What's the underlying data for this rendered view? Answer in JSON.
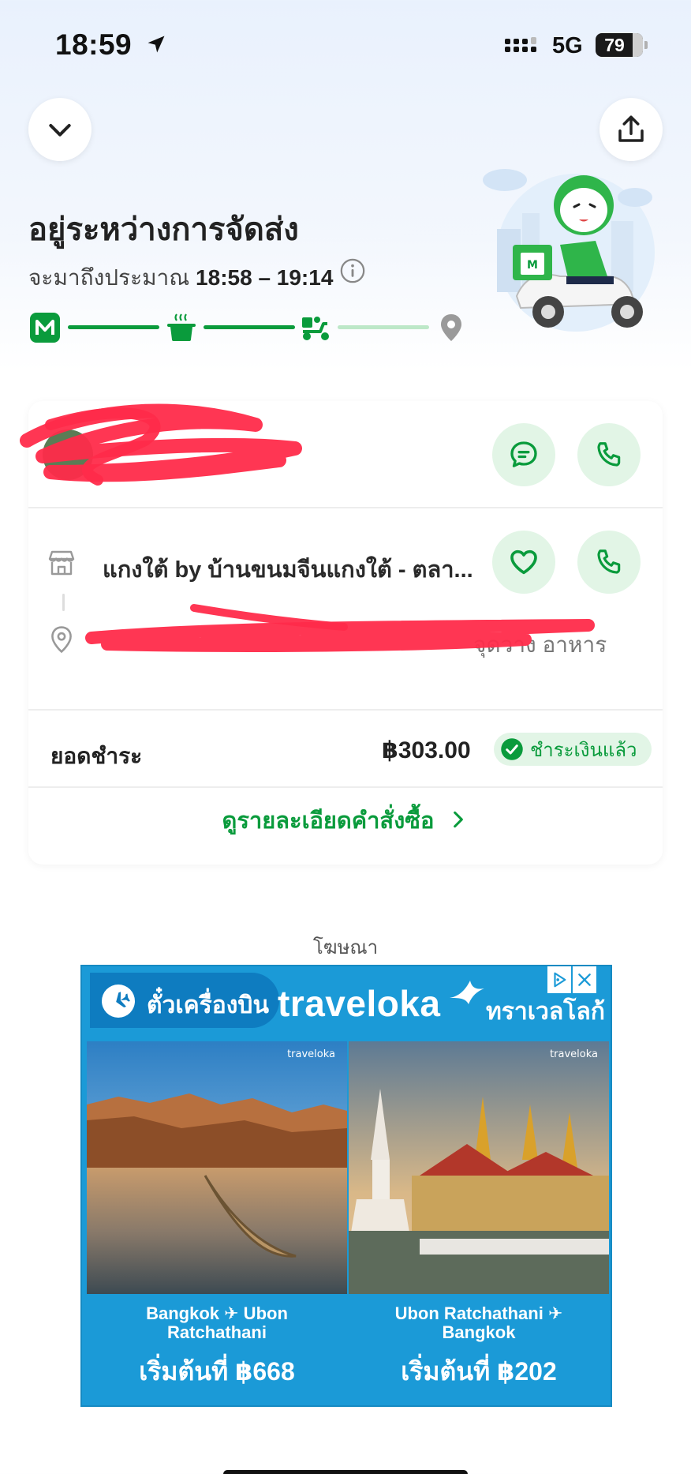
{
  "status_bar": {
    "time": "18:59",
    "network": "5G",
    "battery_level": "79",
    "battery_fraction": 0.79
  },
  "header": {
    "title": "อยู่ระหว่างการจัดส่ง",
    "eta_prefix": "จะมาถึงประมาณ",
    "eta_range": "18:58 – 19:14"
  },
  "progress": {
    "steps": [
      "logo-m-icon",
      "cooking-pot-icon",
      "delivery-scooter-icon",
      "location-pin-icon"
    ],
    "current_step": 3
  },
  "store": {
    "name": "แกงใต้ by บ้านขนมจีนแกงใต้ - ตลา...",
    "address": "จุดวาง อาหาร"
  },
  "payment": {
    "label": "ยอดชำระ",
    "amount": "฿303.00",
    "status": "ชำระเงินแล้ว"
  },
  "details_link": "ดูรายละเอียดคำสั่งซื้อ",
  "ad": {
    "label": "โฆษณา",
    "pill_text": "ตั๋วเครื่องบิน",
    "brand": "traveloka",
    "brand_th": "ทราเวลโลก้า",
    "image_brand": "traveloka",
    "offers": [
      {
        "route_line1": "Bangkok ✈ Ubon",
        "route_line2": "Ratchathani",
        "price": "เริ่มต้นที่ ฿668"
      },
      {
        "route_line1": "Ubon Ratchathani ✈",
        "route_line2": "Bangkok",
        "price": "เริ่มต้นที่ ฿202"
      }
    ]
  },
  "colors": {
    "brand_green": "#0a9b3c",
    "light_green": "#e2f5e6",
    "ad_blue": "#1b9ad7",
    "redaction": "#ff2b4a"
  }
}
